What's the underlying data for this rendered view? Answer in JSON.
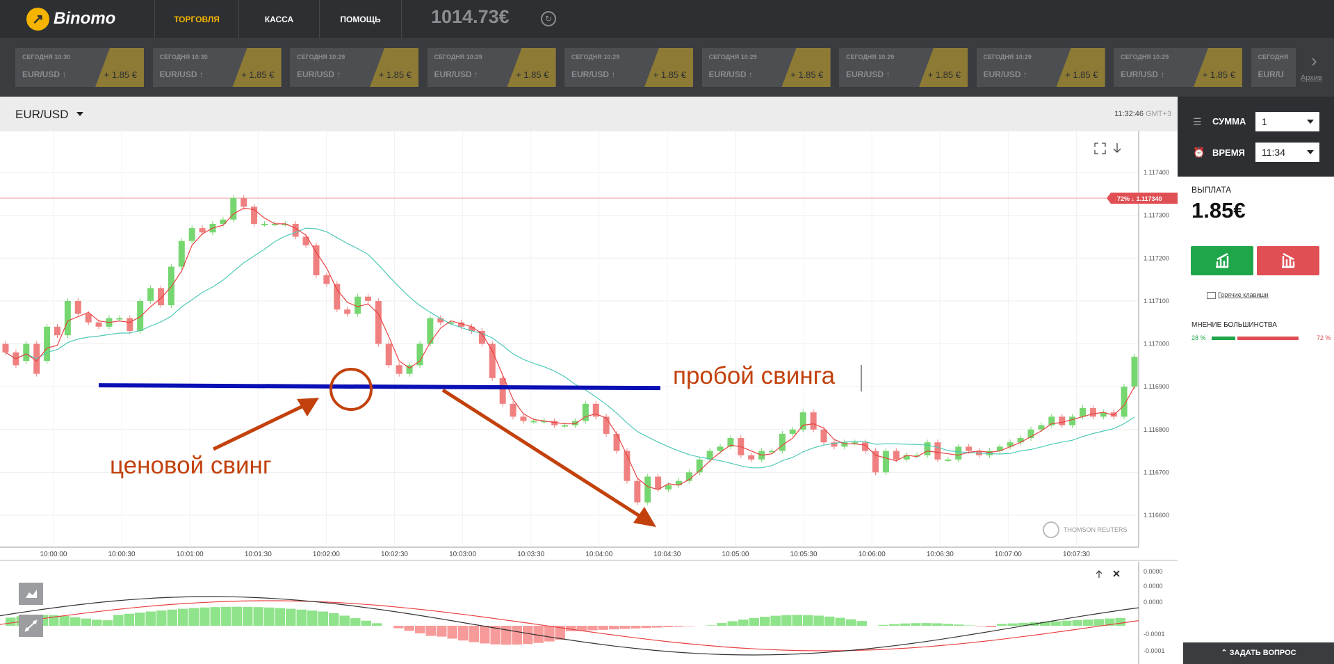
{
  "app": {
    "logo_text": "Binomo",
    "logo_glyph": "↗"
  },
  "nav": {
    "items": [
      "ТОРГОВЛЯ",
      "КАССА",
      "ПОМОЩЬ"
    ],
    "active_color": "#f5b400"
  },
  "balance": "1014.73€",
  "history": {
    "cards": [
      {
        "time": "СЕГОДНЯ 10:30",
        "pair": "EUR/USD ↑",
        "amount": "+ 1.85 €"
      },
      {
        "time": "СЕГОДНЯ 10:30",
        "pair": "EUR/USD ↑",
        "amount": "+ 1.85 €"
      },
      {
        "time": "СЕГОДНЯ 10:29",
        "pair": "EUR/USD ↑",
        "amount": "+ 1.85 €"
      },
      {
        "time": "СЕГОДНЯ 10:29",
        "pair": "EUR/USD ↑",
        "amount": "+ 1.85 €"
      },
      {
        "time": "СЕГОДНЯ 10:29",
        "pair": "EUR/USD ↑",
        "amount": "+ 1.85 €"
      },
      {
        "time": "СЕГОДНЯ 10:29",
        "pair": "EUR/USD ↑",
        "amount": "+ 1.85 €"
      },
      {
        "time": "СЕГОДНЯ 10:29",
        "pair": "EUR/USD ↑",
        "amount": "+ 1.85 €"
      },
      {
        "time": "СЕГОДНЯ 10:29",
        "pair": "EUR/USD ↑",
        "amount": "+ 1.85 €"
      },
      {
        "time": "СЕГОДНЯ 10:29",
        "pair": "EUR/USD ↑",
        "amount": "+ 1.85 €"
      },
      {
        "time": "СЕГОДНЯ",
        "pair": "EUR/U",
        "amount": ""
      }
    ],
    "next_glyph": "›",
    "archive_label": "Архив"
  },
  "chart_header": {
    "pair": "EUR/USD",
    "time": "11:32:46",
    "tz": "GMT+3"
  },
  "chart": {
    "y_ticks": [
      "1.117400",
      "1.117300",
      "1.117200",
      "1.117100",
      "1.117000",
      "1.116900",
      "1.116800",
      "1.116700",
      "1.116600"
    ],
    "x_ticks": [
      "10:00:00",
      "10:00:30",
      "10:01:00",
      "10:01:30",
      "10:02:00",
      "10:02:30",
      "10:03:00",
      "10:03:30",
      "10:04:00",
      "10:04:30",
      "10:05:00",
      "10:05:30",
      "10:06:00",
      "10:06:30",
      "10:07:00",
      "10:07:30"
    ],
    "strike_badge_pct": "72% ↓",
    "strike_badge_price": "1.117340",
    "watermark": "THOMSON REUTERS",
    "macd_ticks": [
      "0.0000",
      "0.0000",
      "0.0000",
      "-0.0001",
      "-0.0001"
    ],
    "colors": {
      "up": "#76d66f",
      "down": "#f08080",
      "fast_ma": "#e84040",
      "slow_ma": "#4ec9b8",
      "annotation": "#c2410c",
      "level_line": "#0a10b4"
    }
  },
  "chart_data": {
    "type": "candlestick",
    "x_range": [
      "10:00:00",
      "10:07:30"
    ],
    "y_range": [
      1.1166,
      1.1174
    ],
    "horizontal_level": 1.1169,
    "strike_level": 1.11734
  },
  "annotations": {
    "breakout": "пробой свинга",
    "swing": "ценовой свинг"
  },
  "right_panel": {
    "sum_label": "СУММА",
    "sum_value": "1",
    "time_label": "ВРЕМЯ",
    "time_value": "11:34",
    "payout_label": "ВЫПЛАТА",
    "payout_value": "1.85€",
    "hotkeys": "Горячие клавиши",
    "opinion_label": "МНЕНИЕ БОЛЬШИНСТВА",
    "opinion_up_pct": "28 %",
    "opinion_down_pct": "72 %",
    "opinion_up": 28,
    "opinion_down": 72,
    "ask_label": "ЗАДАТЬ ВОПРОС"
  }
}
